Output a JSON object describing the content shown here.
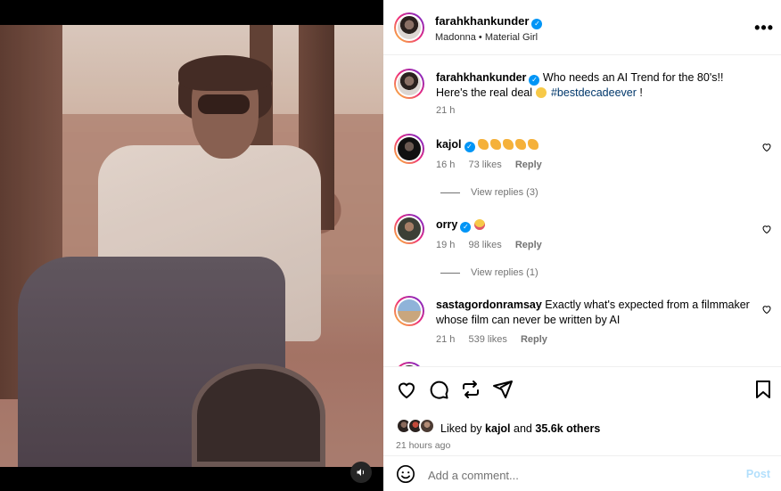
{
  "header": {
    "username": "farahkhankunder",
    "audio": "Madonna • Material Girl",
    "more": "•••"
  },
  "caption": {
    "username": "farahkhankunder",
    "text": "Who needs an AI Trend for the 80's!! Here's the real deal",
    "hashtag": "#bestdecadeever",
    "suffix": "!",
    "time": "21 h"
  },
  "comments": [
    {
      "username": "kajol",
      "text": "",
      "time": "16 h",
      "likes": "73 likes",
      "reply": "Reply",
      "view_replies": "View replies (3)"
    },
    {
      "username": "orry",
      "text": "",
      "time": "19 h",
      "likes": "98 likes",
      "reply": "Reply",
      "view_replies": "View replies (1)"
    },
    {
      "username": "sastagordonramsay",
      "text": "Exactly what's expected from a filmmaker whose film can never be written by AI",
      "time": "21 h",
      "likes": "539 likes",
      "reply": "Reply"
    }
  ],
  "likes_summary": {
    "prefix": "Liked by",
    "user": "kajol",
    "and": "and",
    "others": "35.6k others"
  },
  "posted": "21 hours ago",
  "add_comment": {
    "placeholder": "Add a comment...",
    "post": "Post"
  },
  "colors": {
    "accent": "#0095f6",
    "post_disabled": "#b2dffc",
    "muted": "#737373"
  }
}
